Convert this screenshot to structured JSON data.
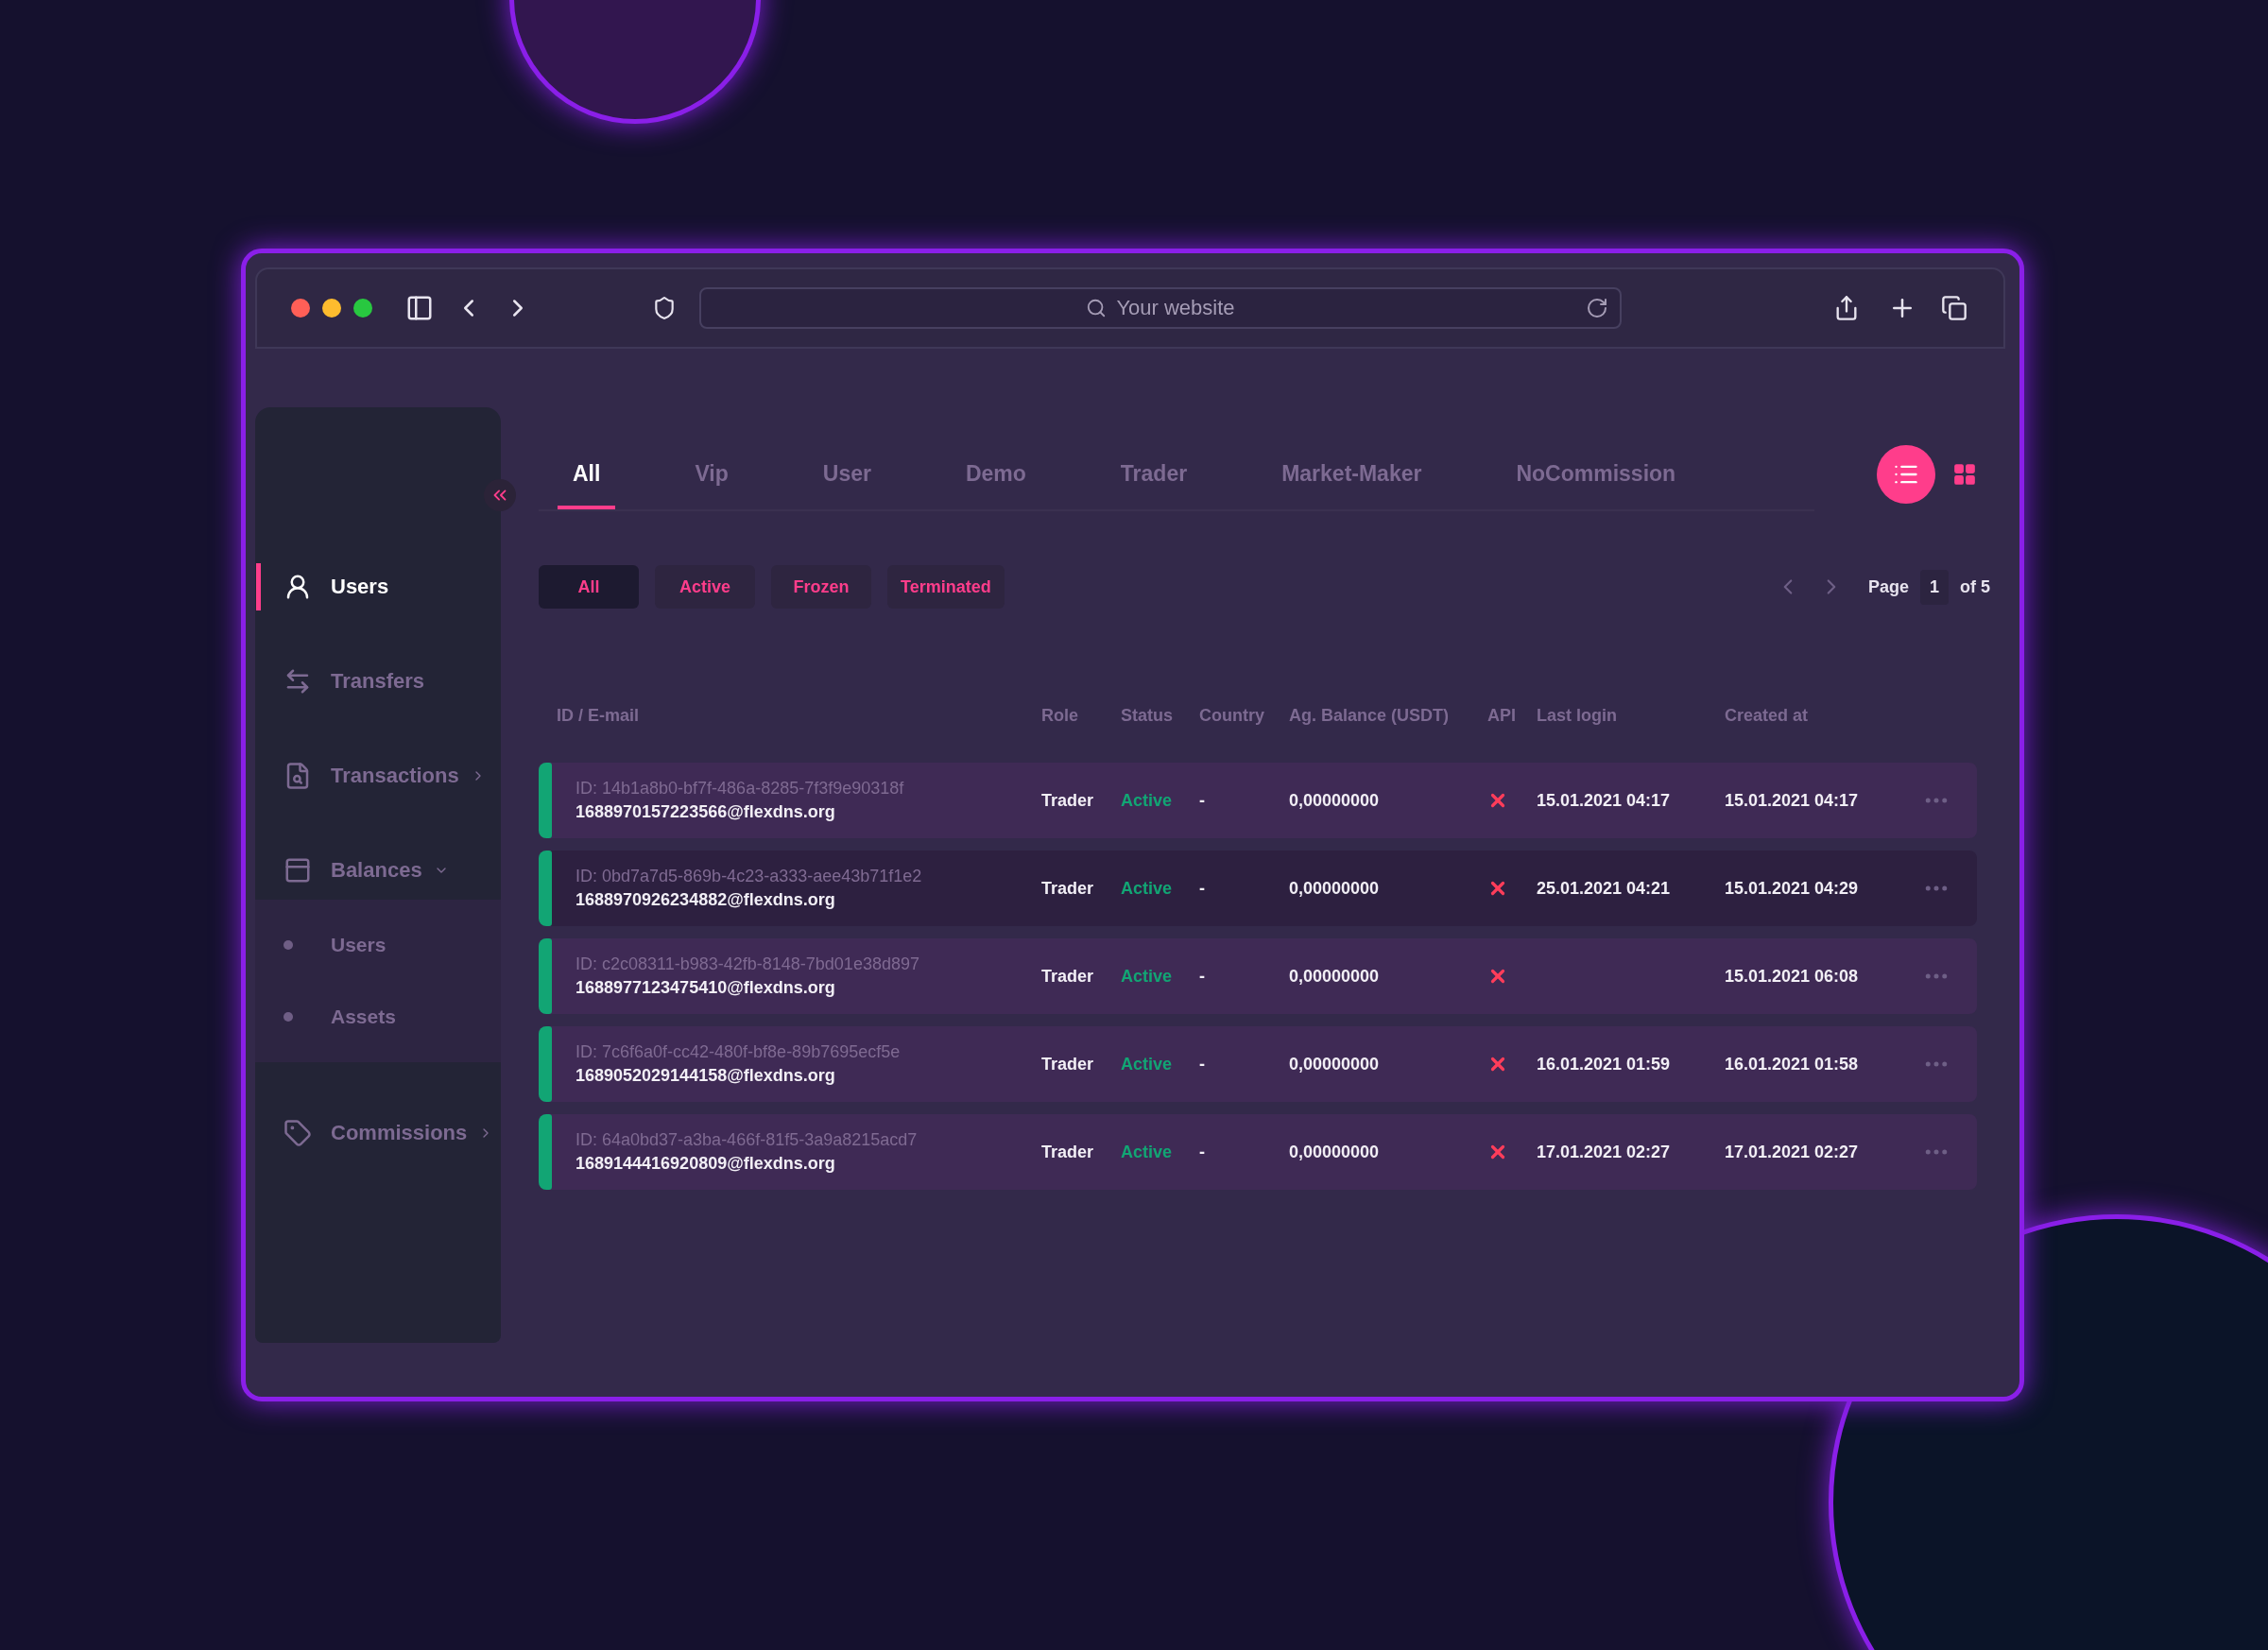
{
  "browser": {
    "address_placeholder": "Your website"
  },
  "sidebar": {
    "items": [
      {
        "label": "Users",
        "kind": "link",
        "selected": true
      },
      {
        "label": "Transfers",
        "kind": "link",
        "selected": false
      },
      {
        "label": "Transactions",
        "kind": "group",
        "selected": false,
        "expanded": false
      },
      {
        "label": "Balances",
        "kind": "group",
        "selected": false,
        "expanded": true,
        "children": [
          {
            "label": "Users"
          },
          {
            "label": "Assets"
          }
        ]
      },
      {
        "label": "Commissions",
        "kind": "group",
        "selected": false,
        "expanded": false
      }
    ]
  },
  "tabs": [
    {
      "label": "All",
      "selected": true
    },
    {
      "label": "Vip",
      "selected": false
    },
    {
      "label": "User",
      "selected": false
    },
    {
      "label": "Demo",
      "selected": false
    },
    {
      "label": "Trader",
      "selected": false
    },
    {
      "label": "Market-Maker",
      "selected": false
    },
    {
      "label": "NoCommission",
      "selected": false
    }
  ],
  "view_toggle": [
    {
      "kind": "list",
      "selected": true
    },
    {
      "kind": "grid",
      "selected": false
    }
  ],
  "filters": [
    {
      "label": "All",
      "selected": true
    },
    {
      "label": "Active",
      "selected": false
    },
    {
      "label": "Frozen",
      "selected": false
    },
    {
      "label": "Terminated",
      "selected": false
    }
  ],
  "pagination": {
    "label": "Page",
    "page": "1",
    "total": "of 5"
  },
  "table": {
    "columns": [
      "ID / E-mail",
      "Role",
      "Status",
      "Country",
      "Ag. Balance (USDT)",
      "API",
      "Last login",
      "Created at"
    ],
    "rows": [
      {
        "id": "ID: 14b1a8b0-bf7f-486a-8285-7f3f9e90318f",
        "email": "1688970157223566@flexdns.org",
        "role": "Trader",
        "status": "Active",
        "country": "-",
        "balance": "0,00000000",
        "api_enabled": false,
        "last_login": "15.01.2021 04:17",
        "created_at": "15.01.2021 04:17",
        "selected": false
      },
      {
        "id": "ID: 0bd7a7d5-869b-4c23-a333-aee43b71f1e2",
        "email": "1688970926234882@flexdns.org",
        "role": "Trader",
        "status": "Active",
        "country": "-",
        "balance": "0,00000000",
        "api_enabled": false,
        "last_login": "25.01.2021 04:21",
        "created_at": "15.01.2021 04:29",
        "selected": true
      },
      {
        "id": "ID: c2c08311-b983-42fb-8148-7bd01e38d897",
        "email": "1688977123475410@flexdns.org",
        "role": "Trader",
        "status": "Active",
        "country": "-",
        "balance": "0,00000000",
        "api_enabled": false,
        "created_at": "15.01.2021 06:08",
        "selected": false
      },
      {
        "id": "ID: 7c6f6a0f-cc42-480f-bf8e-89b7695ecf5e",
        "email": "1689052029144158@flexdns.org",
        "role": "Trader",
        "status": "Active",
        "country": "-",
        "balance": "0,00000000",
        "api_enabled": false,
        "last_login": "16.01.2021 01:59",
        "created_at": "16.01.2021 01:58",
        "selected": false
      },
      {
        "id": "ID: 64a0bd37-a3ba-466f-81f5-3a9a8215acd7",
        "email": "1689144416920809@flexdns.org",
        "role": "Trader",
        "status": "Active",
        "country": "-",
        "balance": "0,00000000",
        "api_enabled": false,
        "last_login": "17.01.2021 02:27",
        "created_at": "17.01.2021 02:27",
        "selected": false
      }
    ]
  }
}
